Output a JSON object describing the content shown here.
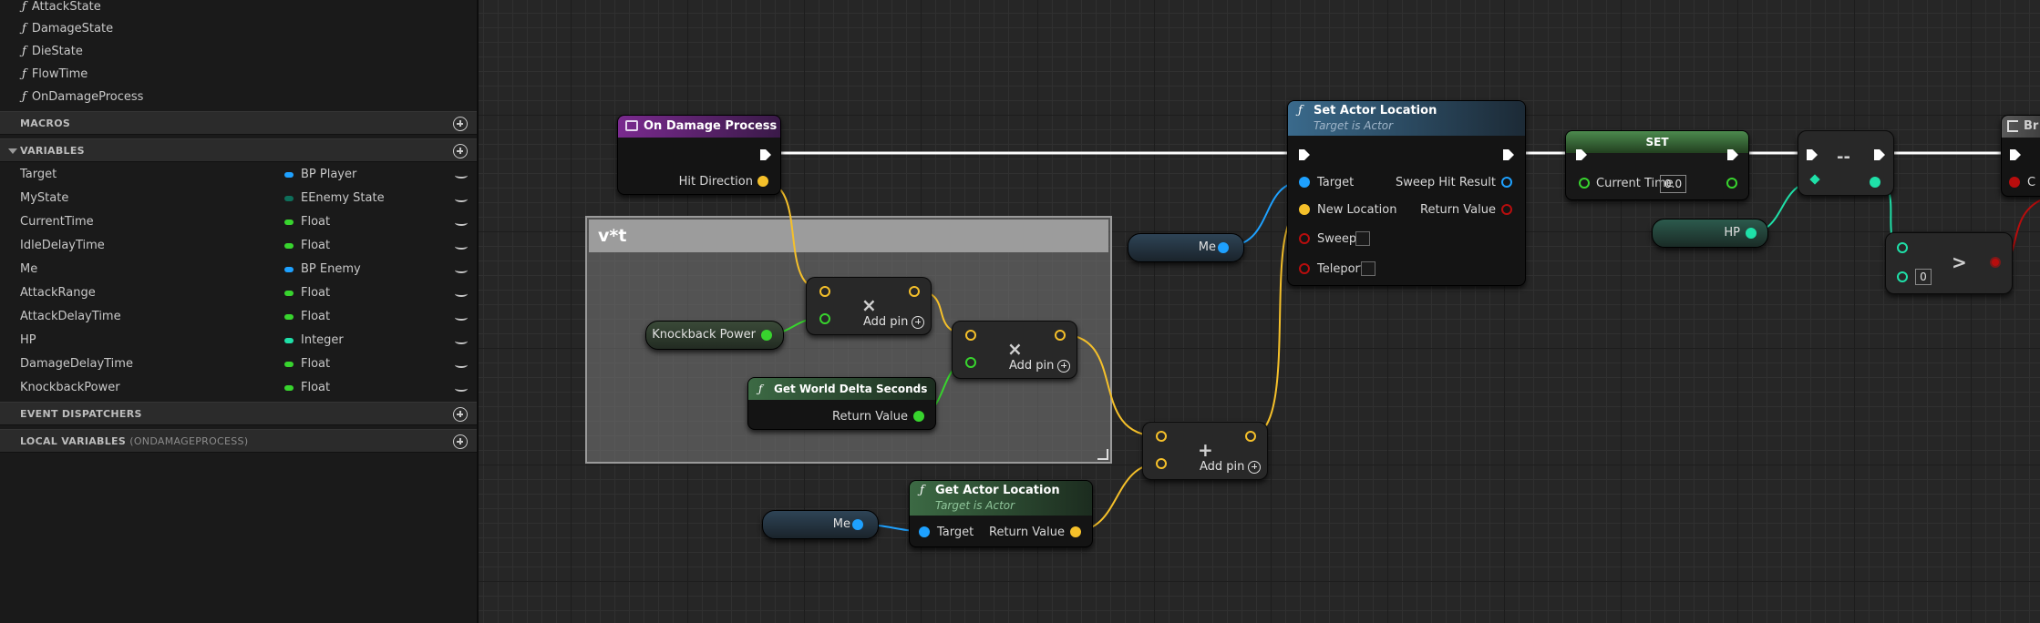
{
  "functions": [
    "AttackState",
    "DamageState",
    "DieState",
    "FlowTime",
    "OnDamageProcess"
  ],
  "categories": {
    "macros": "MACROS",
    "variables": "VARIABLES",
    "event_dispatchers": "EVENT DISPATCHERS",
    "local_variables": "LOCAL VARIABLES",
    "local_variables_scope": "(ONDAMAGEPROCESS)"
  },
  "variables": [
    {
      "name": "Target",
      "type": "BP Player",
      "color": "#1ea1ff"
    },
    {
      "name": "MyState",
      "type": "EEnemy State",
      "color": "#0e6e5a"
    },
    {
      "name": "CurrentTime",
      "type": "Float",
      "color": "#38d42e"
    },
    {
      "name": "IdleDelayTime",
      "type": "Float",
      "color": "#38d42e"
    },
    {
      "name": "Me",
      "type": "BP Enemy",
      "color": "#1ea1ff"
    },
    {
      "name": "AttackRange",
      "type": "Float",
      "color": "#38d42e"
    },
    {
      "name": "AttackDelayTime",
      "type": "Float",
      "color": "#38d42e"
    },
    {
      "name": "HP",
      "type": "Integer",
      "color": "#1fe0a8"
    },
    {
      "name": "DamageDelayTime",
      "type": "Float",
      "color": "#38d42e"
    },
    {
      "name": "KnockbackPower",
      "type": "Float",
      "color": "#38d42e"
    }
  ],
  "graph": {
    "comment_title": "v*t",
    "on_damage": {
      "title": "On Damage Process",
      "pin_hit_direction": "Hit Direction"
    },
    "knockback": {
      "label": "Knockback Power"
    },
    "delta": {
      "title": "Get World Delta Seconds",
      "pin_return": "Return Value"
    },
    "mult_op": "×",
    "add_op": "+",
    "add_pin": "Add pin",
    "me_label": "Me",
    "get_loc": {
      "title": "Get Actor Location",
      "subtitle": "Target is Actor",
      "pin_target": "Target",
      "pin_return": "Return Value"
    },
    "set_loc": {
      "title": "Set Actor Location",
      "subtitle": "Target is Actor",
      "pin_target": "Target",
      "pin_new_location": "New Location",
      "pin_sweep": "Sweep",
      "pin_teleport": "Teleport",
      "out_sweep_hit": "Sweep Hit Result",
      "out_return": "Return Value"
    },
    "set_node": {
      "title": "SET",
      "pin_label": "Current Time",
      "pin_value": "0.0"
    },
    "hp_label": "HP",
    "decrement_op": "--",
    "compare": {
      "op": ">",
      "value": "0"
    },
    "branch": {
      "title": "Br",
      "pin": "C"
    }
  },
  "colors": {
    "float": "#38d42e",
    "object": "#1ea1ff",
    "integer": "#1fe0a8",
    "vector": "#f5c02a",
    "boolean": "#b80d0d",
    "exec": "#ffffff",
    "event_header": "#7a2a8f",
    "function_header": "#2a4f6e",
    "pure_header": "#2e5a36"
  }
}
